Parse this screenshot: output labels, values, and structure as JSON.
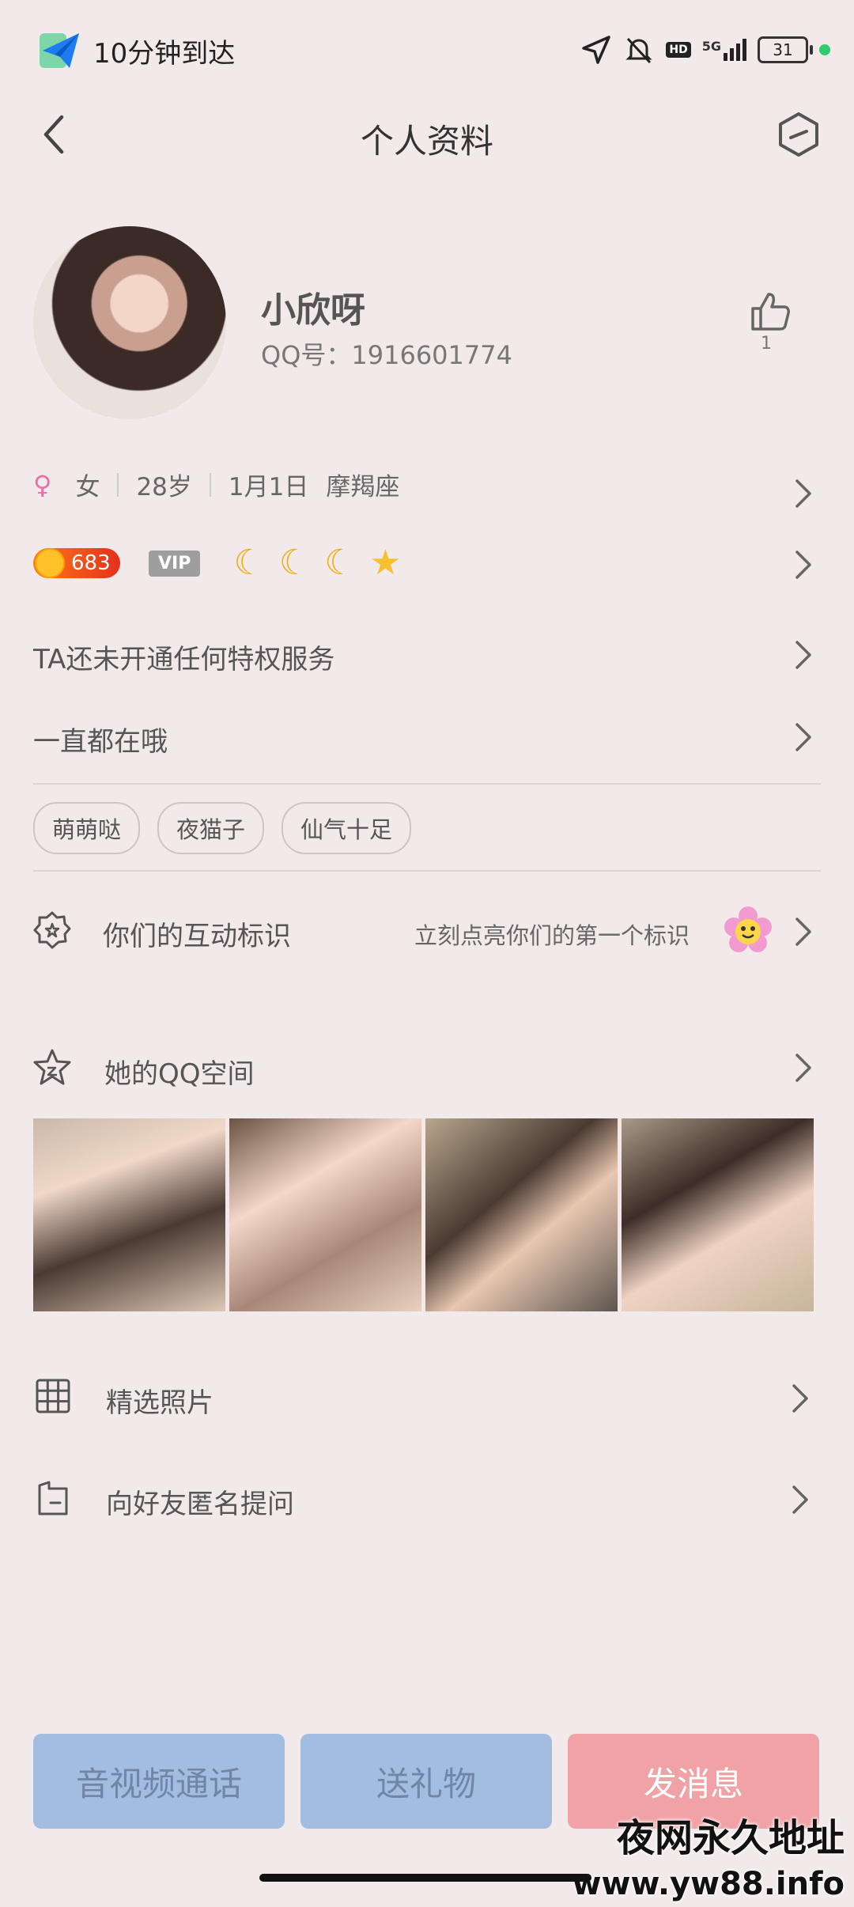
{
  "status_bar": {
    "app_text": "10分钟到达",
    "hd": "HD",
    "net": "5G",
    "battery": "31"
  },
  "header": {
    "title": "个人资料"
  },
  "profile": {
    "name": "小欣呀",
    "qq_label": "QQ号：1916601774",
    "like_count": "1"
  },
  "info": {
    "gender_symbol": "♀",
    "gender": "女",
    "age": "28岁",
    "birthday": "1月1日",
    "zodiac": "摩羯座"
  },
  "badges": {
    "level": "683",
    "vip": "VIP",
    "icons": [
      "moon-icon",
      "moon-icon",
      "moon-icon",
      "star-icon"
    ]
  },
  "rows": {
    "privilege": "TA还未开通任何特权服务",
    "signature": "一直都在哦",
    "interaction_label": "你们的互动标识",
    "interaction_hint": "立刻点亮你们的第一个标识",
    "qzone_label": "她的QQ空间",
    "featured_photos": "精选照片",
    "anonymous_question": "向好友匿名提问"
  },
  "tags": [
    "萌萌哒",
    "夜猫子",
    "仙气十足"
  ],
  "buttons": {
    "call": "音视频通话",
    "gift": "送礼物",
    "message": "发消息"
  },
  "watermark": {
    "line1": "夜网永久地址",
    "line2": "www.yw88.info"
  },
  "colors": {
    "background": "#f2e9ea",
    "button_blue": "#a3bde0",
    "button_red": "#f0a2a6",
    "gender_pink": "#e76fa8"
  }
}
